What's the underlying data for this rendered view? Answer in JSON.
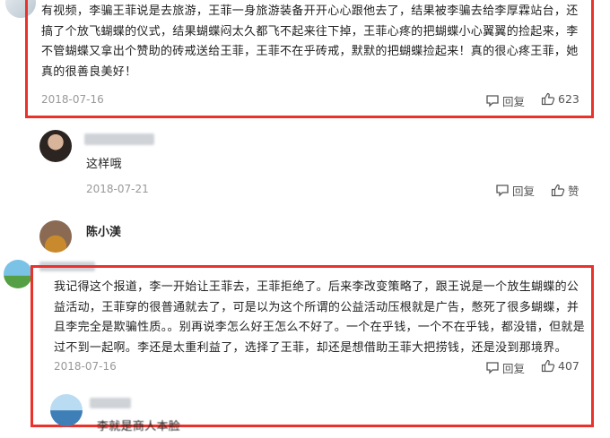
{
  "comments": [
    {
      "text": "有视频，李骗王菲说是去旅游，王菲一身旅游装备开开心心跟他去了，结果被李骗去给李厚霖站台，还搞了个放飞蝴蝶的仪式，结果蝴蝶闷太久都飞不起来往下掉，王菲心疼的把蝴蝶小心翼翼的捡起来，李不管蝴蝶又拿出个赞助的砖戒送给王菲，王菲不在乎砖戒，默默的把蝴蝶捡起来！真的很心疼王菲，她真的很善良美好！",
      "date": "2018-07-16",
      "reply_label": "回复",
      "like_count": "623"
    },
    {
      "text": "这样哦",
      "date": "2018-07-21",
      "reply_label": "回复",
      "like_label": "赞"
    },
    {
      "username": "陈小渼"
    },
    {
      "text": "我记得这个报道，李一开始让王菲去，王菲拒绝了。后来李改变策略了，跟王说是一个放生蝴蝶的公益活动，王菲穿的很普通就去了，可是以为这个所谓的公益活动压根就是广告，憋死了很多蝴蝶，并且李完全是欺骗性质。。别再说李怎么好王怎么不好了。一个在乎钱，一个不在乎钱，都没错，但就是过不到一起啊。李还是太重利益了，选择了王菲，却还是想借助王菲大把捞钱，还是没到那境界。",
      "date": "2018-07-16",
      "reply_label": "回复",
      "like_count": "407"
    },
    {
      "partial_text": "李就是商人本脸"
    }
  ],
  "colors": {
    "highlight_border": "#e8322b",
    "meta_text": "#999999"
  }
}
